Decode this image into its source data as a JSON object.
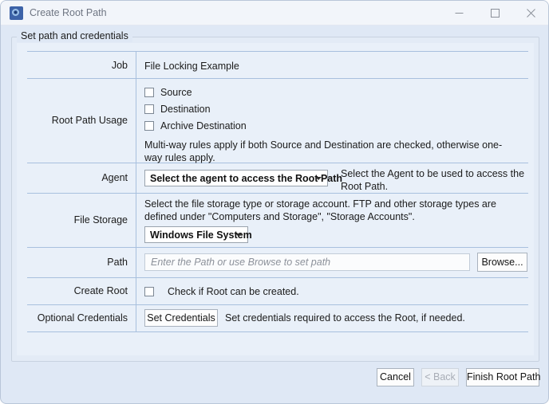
{
  "window": {
    "title": "Create Root Path",
    "icon": "app-ring-icon",
    "controls": {
      "minimize": "minimize-icon",
      "maximize": "maximize-icon",
      "close": "close-icon"
    }
  },
  "group": {
    "legend": "Set path and credentials"
  },
  "form": {
    "job": {
      "label": "Job",
      "value": "File Locking Example"
    },
    "root_path_usage": {
      "label": "Root Path Usage",
      "checkboxes": [
        {
          "label": "Source",
          "checked": false
        },
        {
          "label": "Destination",
          "checked": false
        },
        {
          "label": "Archive Destination",
          "checked": false
        }
      ],
      "note": "Multi-way rules apply if both Source and Destination are checked, otherwise one-way rules apply."
    },
    "agent": {
      "label": "Agent",
      "selected": "Select the agent to access the Root Path",
      "description": "Select the Agent to be used to access the Root Path."
    },
    "file_storage": {
      "label": "File Storage",
      "description": "Select the file storage type or storage account. FTP and other storage types are defined under \"Computers and Storage\", \"Storage Accounts\".",
      "selected": "Windows File System"
    },
    "path": {
      "label": "Path",
      "value": "",
      "placeholder": "Enter the Path or use Browse to set path",
      "browse_label": "Browse..."
    },
    "create_root": {
      "label": "Create Root",
      "checkbox_label": "Check if Root can be created.",
      "checked": false
    },
    "optional_credentials": {
      "label": "Optional Credentials",
      "button_label": "Set Credentials",
      "description": "Set credentials required to access the Root, if needed."
    }
  },
  "footer": {
    "cancel": "Cancel",
    "back": "< Back",
    "back_disabled": true,
    "finish": "Finish Root Path"
  },
  "colors": {
    "window_bg": "#dfe8f5",
    "titlebar_bg": "#f2f5fa",
    "panel_bg": "#e9f0f9",
    "rule": "#a8c0de",
    "accent_icon": "#3d63a8"
  }
}
